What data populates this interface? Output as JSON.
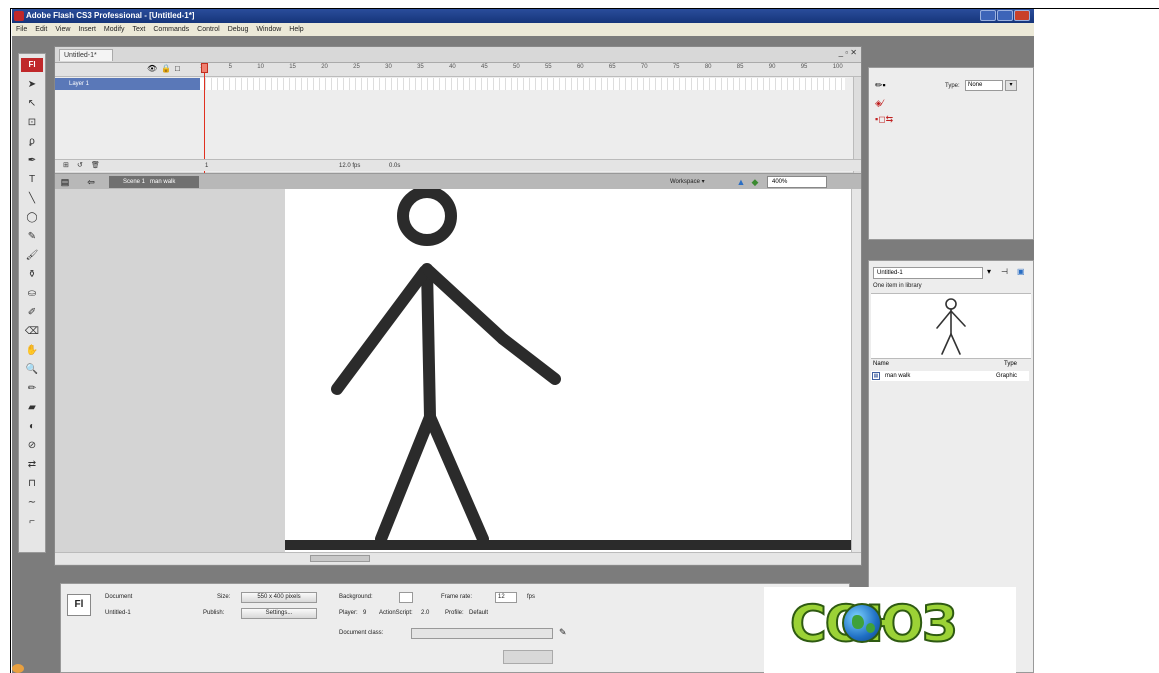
{
  "window": {
    "title": "Adobe Flash CS3 Professional - [Untitled-1*]"
  },
  "menu": [
    "File",
    "Edit",
    "View",
    "Insert",
    "Modify",
    "Text",
    "Commands",
    "Control",
    "Debug",
    "Window",
    "Help"
  ],
  "toolbar": {
    "badge": "Fl",
    "tools": [
      {
        "name": "selection-tool-icon",
        "glyph": "➤"
      },
      {
        "name": "subselection-tool-icon",
        "glyph": "↖"
      },
      {
        "name": "free-transform-tool-icon",
        "glyph": "⊡"
      },
      {
        "name": "lasso-tool-icon",
        "glyph": "ϼ"
      },
      {
        "name": "pen-tool-icon",
        "glyph": "✒"
      },
      {
        "name": "text-tool-icon",
        "glyph": "T"
      },
      {
        "name": "line-tool-icon",
        "glyph": "╲"
      },
      {
        "name": "oval-tool-icon",
        "glyph": "◯"
      },
      {
        "name": "pencil-tool-icon",
        "glyph": "✎"
      },
      {
        "name": "brush-tool-icon",
        "glyph": "🖌"
      },
      {
        "name": "ink-bottle-tool-icon",
        "glyph": "⚱"
      },
      {
        "name": "paint-bucket-tool-icon",
        "glyph": "⛀"
      },
      {
        "name": "eyedropper-tool-icon",
        "glyph": "✐"
      },
      {
        "name": "eraser-tool-icon",
        "glyph": "⌫"
      },
      {
        "name": "hand-tool-icon",
        "glyph": "✋"
      },
      {
        "name": "zoom-tool-icon",
        "glyph": "🔍"
      },
      {
        "name": "stroke-color-icon",
        "glyph": "✏"
      },
      {
        "name": "fill-color-icon",
        "glyph": "▰"
      },
      {
        "name": "black-white-icon",
        "glyph": "◐"
      },
      {
        "name": "no-color-icon",
        "glyph": "⊘"
      },
      {
        "name": "swap-colors-icon",
        "glyph": "⇄"
      },
      {
        "name": "snap-icon",
        "glyph": "⊓"
      },
      {
        "name": "smooth-icon",
        "glyph": "∼"
      },
      {
        "name": "straighten-icon",
        "glyph": "⌐"
      }
    ]
  },
  "document": {
    "tab_label": "Untitled-1*",
    "window_controls": "_ ▫ ✕",
    "timeline": {
      "frame_numbers": [
        "1",
        "5",
        "10",
        "15",
        "20",
        "25",
        "30",
        "35",
        "40",
        "45",
        "50",
        "55",
        "60",
        "65",
        "70",
        "75",
        "80",
        "85",
        "90",
        "95",
        "100"
      ],
      "layer_name": "Layer 1",
      "current_frame": "1",
      "frame_rate": "12.0 fps",
      "elapsed": "0.0s"
    },
    "edit_bar": {
      "scene": "Scene 1",
      "symbol": "man walk",
      "workspace_label": "Workspace ▾",
      "zoom": "400%"
    }
  },
  "properties_panel": {
    "type_label": "Type:",
    "type_value": "None"
  },
  "library_panel": {
    "document": "Untitled-1",
    "item_count": "One item in library",
    "col_name": "Name",
    "col_type": "Type",
    "item_name": "man walk",
    "item_type": "Graphic"
  },
  "document_properties": {
    "doc_label": "Document",
    "doc_name": "Untitled-1",
    "size_label": "Size:",
    "size_value": "550 x 400 pixels",
    "publish_label": "Publish:",
    "settings_btn": "Settings...",
    "background_label": "Background:",
    "frame_rate_label": "Frame rate:",
    "frame_rate_value": "12",
    "fps_unit": "fps",
    "player_label": "Player:",
    "player_value": "9",
    "actionscript_label": "ActionScript:",
    "actionscript_value": "2.0",
    "profile_label": "Profile:",
    "profile_value": "Default",
    "doc_class_label": "Document class:"
  },
  "logo": {
    "text": "СОЮЗ"
  }
}
